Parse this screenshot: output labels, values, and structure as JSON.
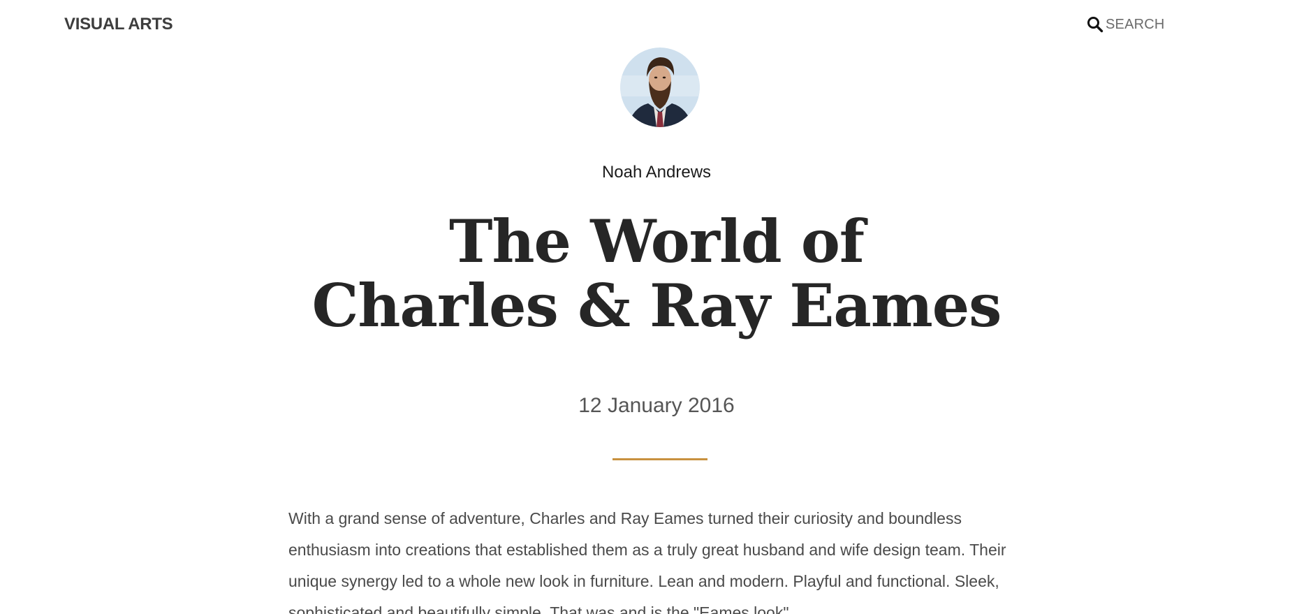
{
  "header": {
    "brand": "VISUAL ARTS",
    "search_label": "SEARCH",
    "search_icon": "search-icon"
  },
  "article": {
    "author": {
      "name": "Noah Andrews",
      "avatar_icon": "author-avatar"
    },
    "title_lines": [
      "The World of",
      "Charles & Ray Eames"
    ],
    "date": "12 January 2016",
    "accent_color": "#c8913f",
    "body": "With a grand sense of adventure, Charles and Ray Eames turned their curiosity and boundless enthusiasm into creations that established them as a truly great husband and wife design team. Their unique synergy led to a whole new look in furniture. Lean and modern. Playful and functional. Sleek, sophisticated and beautifully simple. That was and is the \"Eames look\"."
  }
}
